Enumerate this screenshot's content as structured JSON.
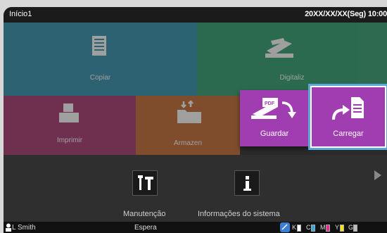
{
  "topbar": {
    "title": "Início1",
    "datetime": "20XX/XX/XX(Seg) 10:00"
  },
  "tiles": {
    "copiar": "Copiar",
    "digitalizar": "Digitaliz",
    "imprimir": "Imprimir",
    "armazenar": "Armazen",
    "guardar": "Guardar",
    "carregar": "Carregar"
  },
  "bottom": {
    "manutencao": "Manutenção",
    "informacoes": "Informações do sistema"
  },
  "status": {
    "user": "L Smith",
    "state": "Espera",
    "inks": [
      {
        "label": "K",
        "color": "#ffffff"
      },
      {
        "label": "C",
        "color": "#3aa8e0"
      },
      {
        "label": "M",
        "color": "#e0308a"
      },
      {
        "label": "Y",
        "color": "#f2e02a"
      },
      {
        "label": "G",
        "color": "#bbbbbb"
      }
    ]
  }
}
